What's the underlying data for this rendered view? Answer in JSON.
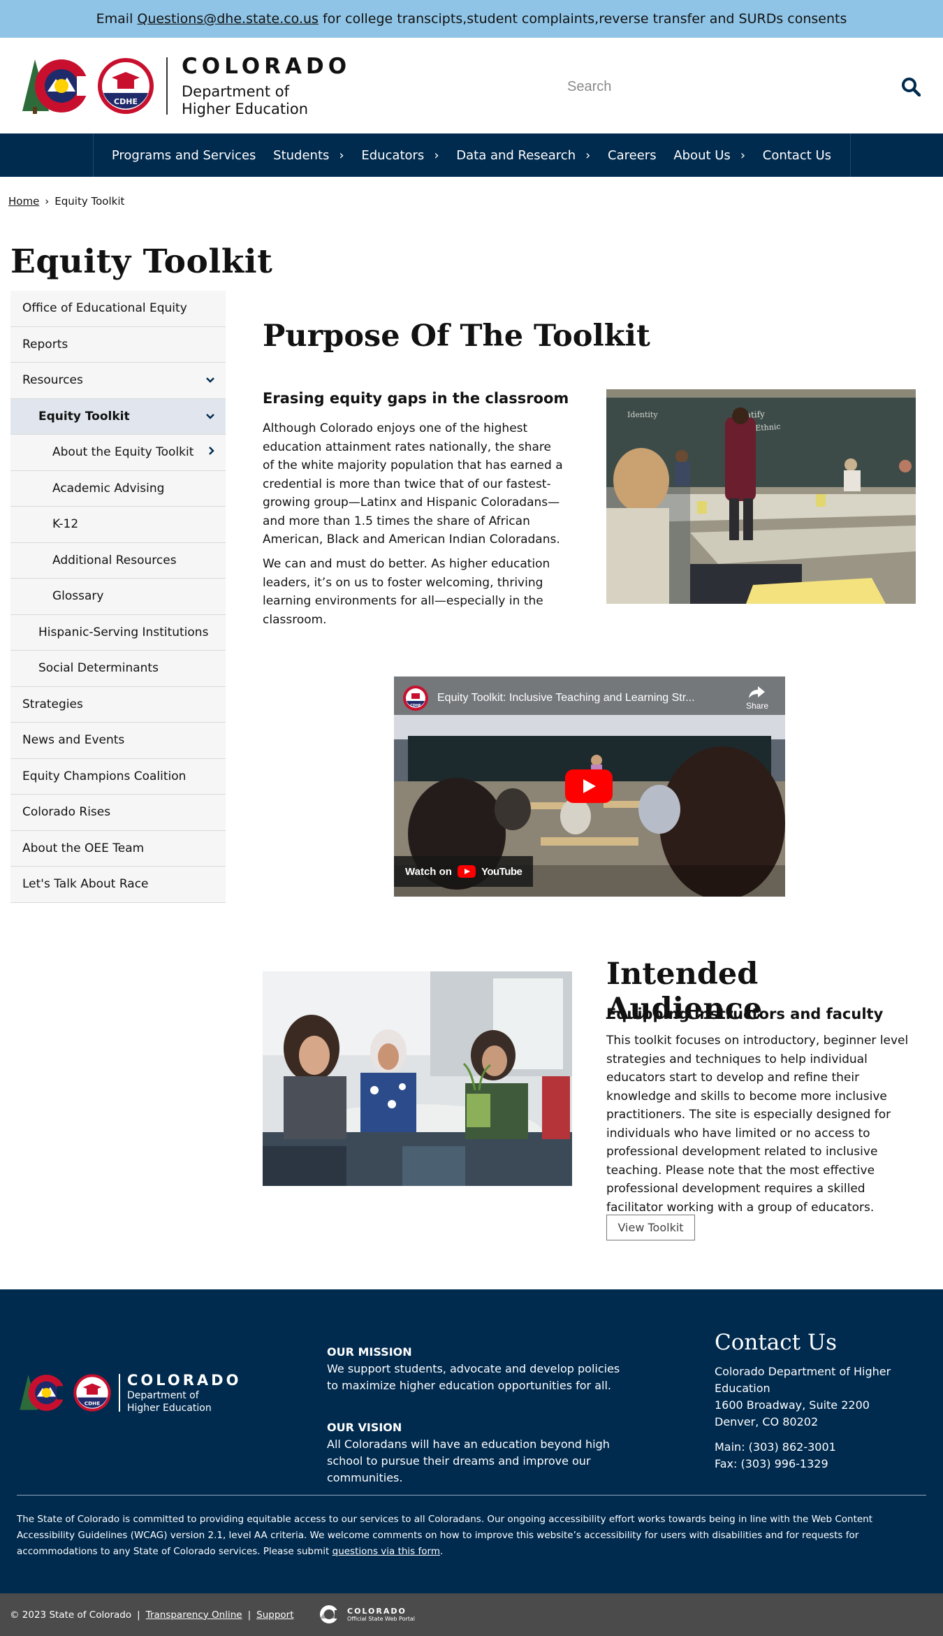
{
  "alert": {
    "prefix": "Email",
    "email": "Questions@dhe.state.co.us",
    "suffix": "for college transcipts,student complaints,reverse transfer and SURDs consents"
  },
  "header": {
    "logo_wordmark": "COLORADO",
    "logo_dept_line1": "Department of",
    "logo_dept_line2": "Higher Education",
    "logo_badge": "CDHE",
    "search_placeholder": "Search"
  },
  "nav": {
    "items": [
      {
        "label": "Programs and Services",
        "chevron": ""
      },
      {
        "label": "Students",
        "chevron": "›"
      },
      {
        "label": "Educators",
        "chevron": "›"
      },
      {
        "label": "Data and Research",
        "chevron": "›"
      },
      {
        "label": "Careers",
        "chevron": ""
      },
      {
        "label": "About Us",
        "chevron": "›"
      },
      {
        "label": "Contact Us",
        "chevron": ""
      }
    ]
  },
  "breadcrumb": {
    "home": "Home",
    "separator": "›",
    "current": "Equity Toolkit"
  },
  "page": {
    "title": "Equity Toolkit"
  },
  "sidebar": {
    "items": [
      {
        "label": "Office of Educational Equity",
        "chevron": ""
      },
      {
        "label": "Reports",
        "chevron": ""
      },
      {
        "label": "Resources",
        "chevron": "⌄"
      },
      {
        "label": "Equity Toolkit",
        "chevron": "⌄"
      },
      {
        "label": "About the Equity Toolkit",
        "chevron": "›"
      },
      {
        "label": "Academic Advising",
        "chevron": ""
      },
      {
        "label": "K-12",
        "chevron": ""
      },
      {
        "label": "Additional Resources",
        "chevron": ""
      },
      {
        "label": "Glossary",
        "chevron": ""
      },
      {
        "label": "Hispanic-Serving Institutions",
        "chevron": ""
      },
      {
        "label": "Social Determinants",
        "chevron": ""
      },
      {
        "label": "Strategies",
        "chevron": ""
      },
      {
        "label": "News and Events",
        "chevron": ""
      },
      {
        "label": "Equity Champions Coalition",
        "chevron": ""
      },
      {
        "label": "Colorado Rises",
        "chevron": ""
      },
      {
        "label": "About the OEE Team",
        "chevron": ""
      },
      {
        "label": "Let's Talk About Race",
        "chevron": ""
      }
    ]
  },
  "main": {
    "purpose_heading": "Purpose Of The Toolkit",
    "purpose_subheading": "Erasing equity gaps in the classroom",
    "purpose_p1": "Although Colorado enjoys one of the highest education attainment rates nationally, the share of the white majority population that has earned a credential is more than twice that of our fastest-growing group—Latinx and Hispanic Coloradans—and more than 1.5 times the share of African American, Black and American Indian Coloradans.",
    "purpose_p2": "We can and must do better. As higher education leaders, it’s on us to foster welcoming, thriving learning environments for all—especially in the classroom.",
    "chalkboard_text1": "Identify",
    "chalkboard_text2": "Racial/Ethnic",
    "chalkboard_text3": "Identity",
    "video": {
      "title": "Equity Toolkit: Inclusive Teaching and Learning Str...",
      "share": "Share",
      "watch_on": "Watch on",
      "youtube": "YouTube",
      "channel_badge": "CDHE"
    },
    "audience_heading": "Intended Audience",
    "audience_subheading": "Equipping instructors and faculty",
    "audience_p": "This toolkit focuses on introductory, beginner level strategies and techniques to help individual educators start to develop and refine their knowledge and skills to become more inclusive practitioners. The site is especially designed for individuals who have limited or no access to professional development related to inclusive teaching. Please note that the most effective professional development requires a skilled facilitator working with a group of educators.",
    "view_toolkit": "View Toolkit"
  },
  "footer": {
    "logo_wordmark": "COLORADO",
    "logo_dept_line1": "Department of",
    "logo_dept_line2": "Higher Education",
    "logo_badge": "CDHE",
    "mission_title": "OUR MISSION",
    "mission_text": "We support students, advocate and develop policies to maximize higher education opportunities for all.",
    "vision_title": "OUR VISION",
    "vision_text": "All Coloradans will have an education beyond high school to pursue their dreams and improve our communities.",
    "contact_title": "Contact Us",
    "address1": "Colorado Department of Higher Education",
    "address2": "1600 Broadway, Suite 2200",
    "address3": "Denver, CO 80202",
    "main_phone": "Main: (303) 862-3001",
    "fax": "Fax: (303) 996-1329",
    "accessibility_text": "The State of Colorado is committed to providing equitable access to our services to all Coloradans. Our ongoing accessibility effort works towards being in line with the Web Content Accessibility Guidelines (WCAG) version 2.1, level AA criteria. We welcome comments on how to improve this website’s accessibility for users with disabilities and for requests for accommodations to any State of Colorado services. Please submit",
    "accessibility_link": "questions via this form",
    "accessibility_end": "."
  },
  "subfooter": {
    "copyright": "© 2023 State of Colorado",
    "sep": "|",
    "transparency": "Transparency Online",
    "support": "Support",
    "portal_title": "COLORADO",
    "portal_sub": "Official State Web Portal"
  },
  "colors": {
    "navy": "#002a4e",
    "alert_blue": "#8fc4e6",
    "logo_red": "#c8102e",
    "logo_blue": "#1f2a6b",
    "logo_yellow": "#ffd100",
    "logo_green": "#2e6b3a"
  }
}
